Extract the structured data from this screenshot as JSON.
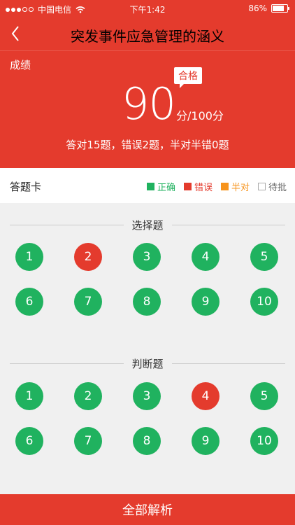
{
  "status_bar": {
    "carrier": "中国电信",
    "time": "下午1:42",
    "battery": "86%"
  },
  "nav": {
    "title": "突发事件应急管理的涵义"
  },
  "score_panel": {
    "label": "成绩",
    "badge": "合格",
    "score": "90",
    "unit": "分/100分",
    "summary": "答对15题，错误2题，半对半错0题"
  },
  "answer_card": {
    "title": "答题卡",
    "legend": [
      {
        "label": "正确",
        "color": "#20b25f",
        "text_color": "#20b25f"
      },
      {
        "label": "错误",
        "color": "#e43b2d",
        "text_color": "#e43b2d"
      },
      {
        "label": "半对",
        "color": "#f7941d",
        "text_color": "#f7941d"
      },
      {
        "label": "待批",
        "color": "#ffffff",
        "text_color": "#666666"
      }
    ]
  },
  "sections": [
    {
      "title": "选择题",
      "questions": [
        {
          "num": "1",
          "status": "correct"
        },
        {
          "num": "2",
          "status": "wrong"
        },
        {
          "num": "3",
          "status": "correct"
        },
        {
          "num": "4",
          "status": "correct"
        },
        {
          "num": "5",
          "status": "correct"
        },
        {
          "num": "6",
          "status": "correct"
        },
        {
          "num": "7",
          "status": "correct"
        },
        {
          "num": "8",
          "status": "correct"
        },
        {
          "num": "9",
          "status": "correct"
        },
        {
          "num": "10",
          "status": "correct"
        }
      ]
    },
    {
      "title": "判断题",
      "questions": [
        {
          "num": "1",
          "status": "correct"
        },
        {
          "num": "2",
          "status": "correct"
        },
        {
          "num": "3",
          "status": "correct"
        },
        {
          "num": "4",
          "status": "wrong"
        },
        {
          "num": "5",
          "status": "correct"
        },
        {
          "num": "6",
          "status": "correct"
        },
        {
          "num": "7",
          "status": "correct"
        },
        {
          "num": "8",
          "status": "correct"
        },
        {
          "num": "9",
          "status": "correct"
        },
        {
          "num": "10",
          "status": "correct"
        }
      ]
    }
  ],
  "footer": {
    "label": "全部解析"
  }
}
